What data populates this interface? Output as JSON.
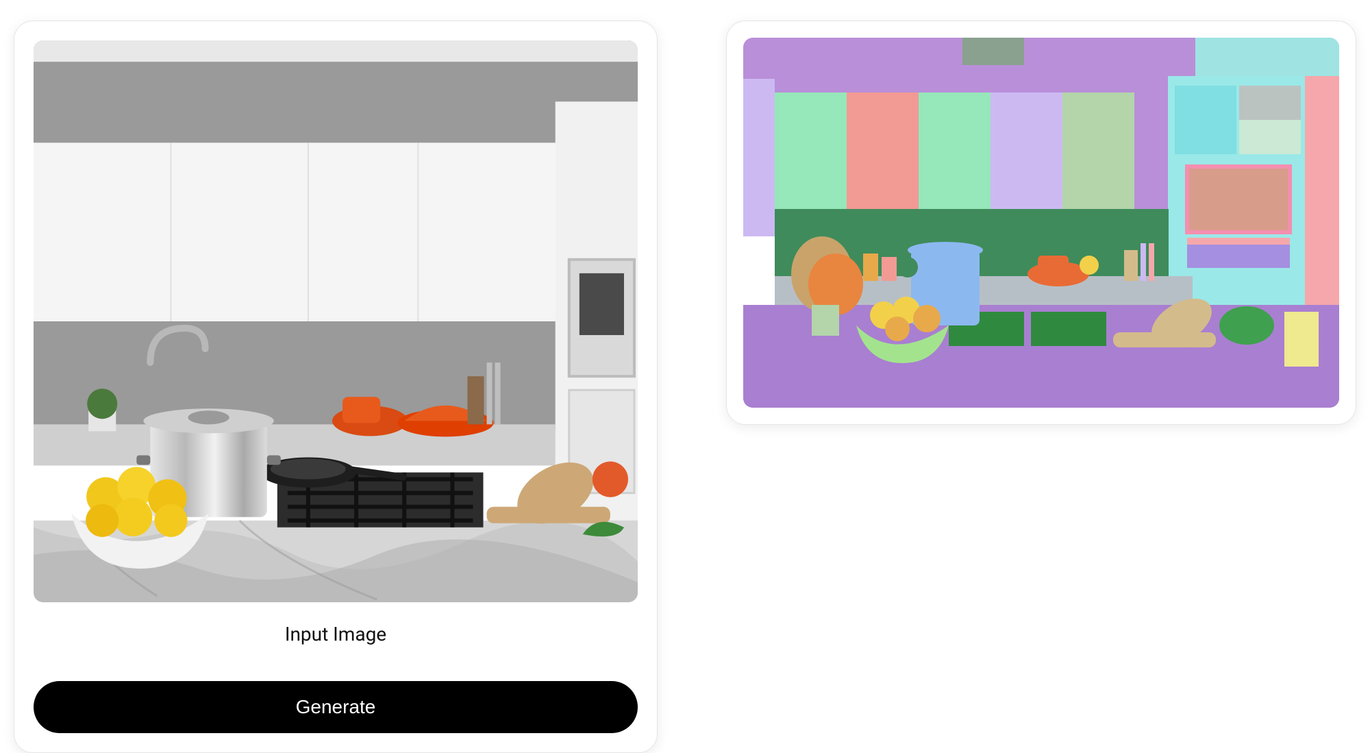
{
  "input_card": {
    "caption": "Input Image",
    "generate_label": "Generate",
    "image_description": "kitchen-photo"
  },
  "output_card": {
    "image_description": "segmentation-map"
  },
  "segmentation_colors": {
    "wall_upper": "#b98fd9",
    "ceiling_patch": "#8aa18f",
    "ceiling_right": "#9fe3e3",
    "cabinet_mint": "#96e7ba",
    "cabinet_pink": "#f29a94",
    "cabinet_lilac": "#cdb9f2",
    "cabinet_sage": "#b3d5a9",
    "cabinet_cyan": "#7fdfe2",
    "cabinet_grey": "#b9bfbf",
    "wall_pink_far": "#f6a7ac",
    "backsplash_green": "#3f8b5b",
    "oven_frame_cyan": "#9ae8e8",
    "oven_window": "#d89c8a",
    "oven_panel": "#a58fe0",
    "counter_back_grey": "#b7bfc6",
    "counter_front_purple": "#a97fd1",
    "pot_blue": "#8cb8f0",
    "fruit_bowl": "#a3e38e",
    "fruit1": "#f2d04a",
    "fruit2": "#e8a94a",
    "flowers_orange": "#e8853f",
    "flowers_tan": "#c9a36a",
    "orange_pot": "#e86b35",
    "stove_green": "#2f8a3f",
    "cutting_board": "#d4bb8b",
    "herbs": "#3fa04f",
    "far_right_yellow": "#efe98f",
    "cabinet_right_mint2": "#cbe9d4"
  }
}
